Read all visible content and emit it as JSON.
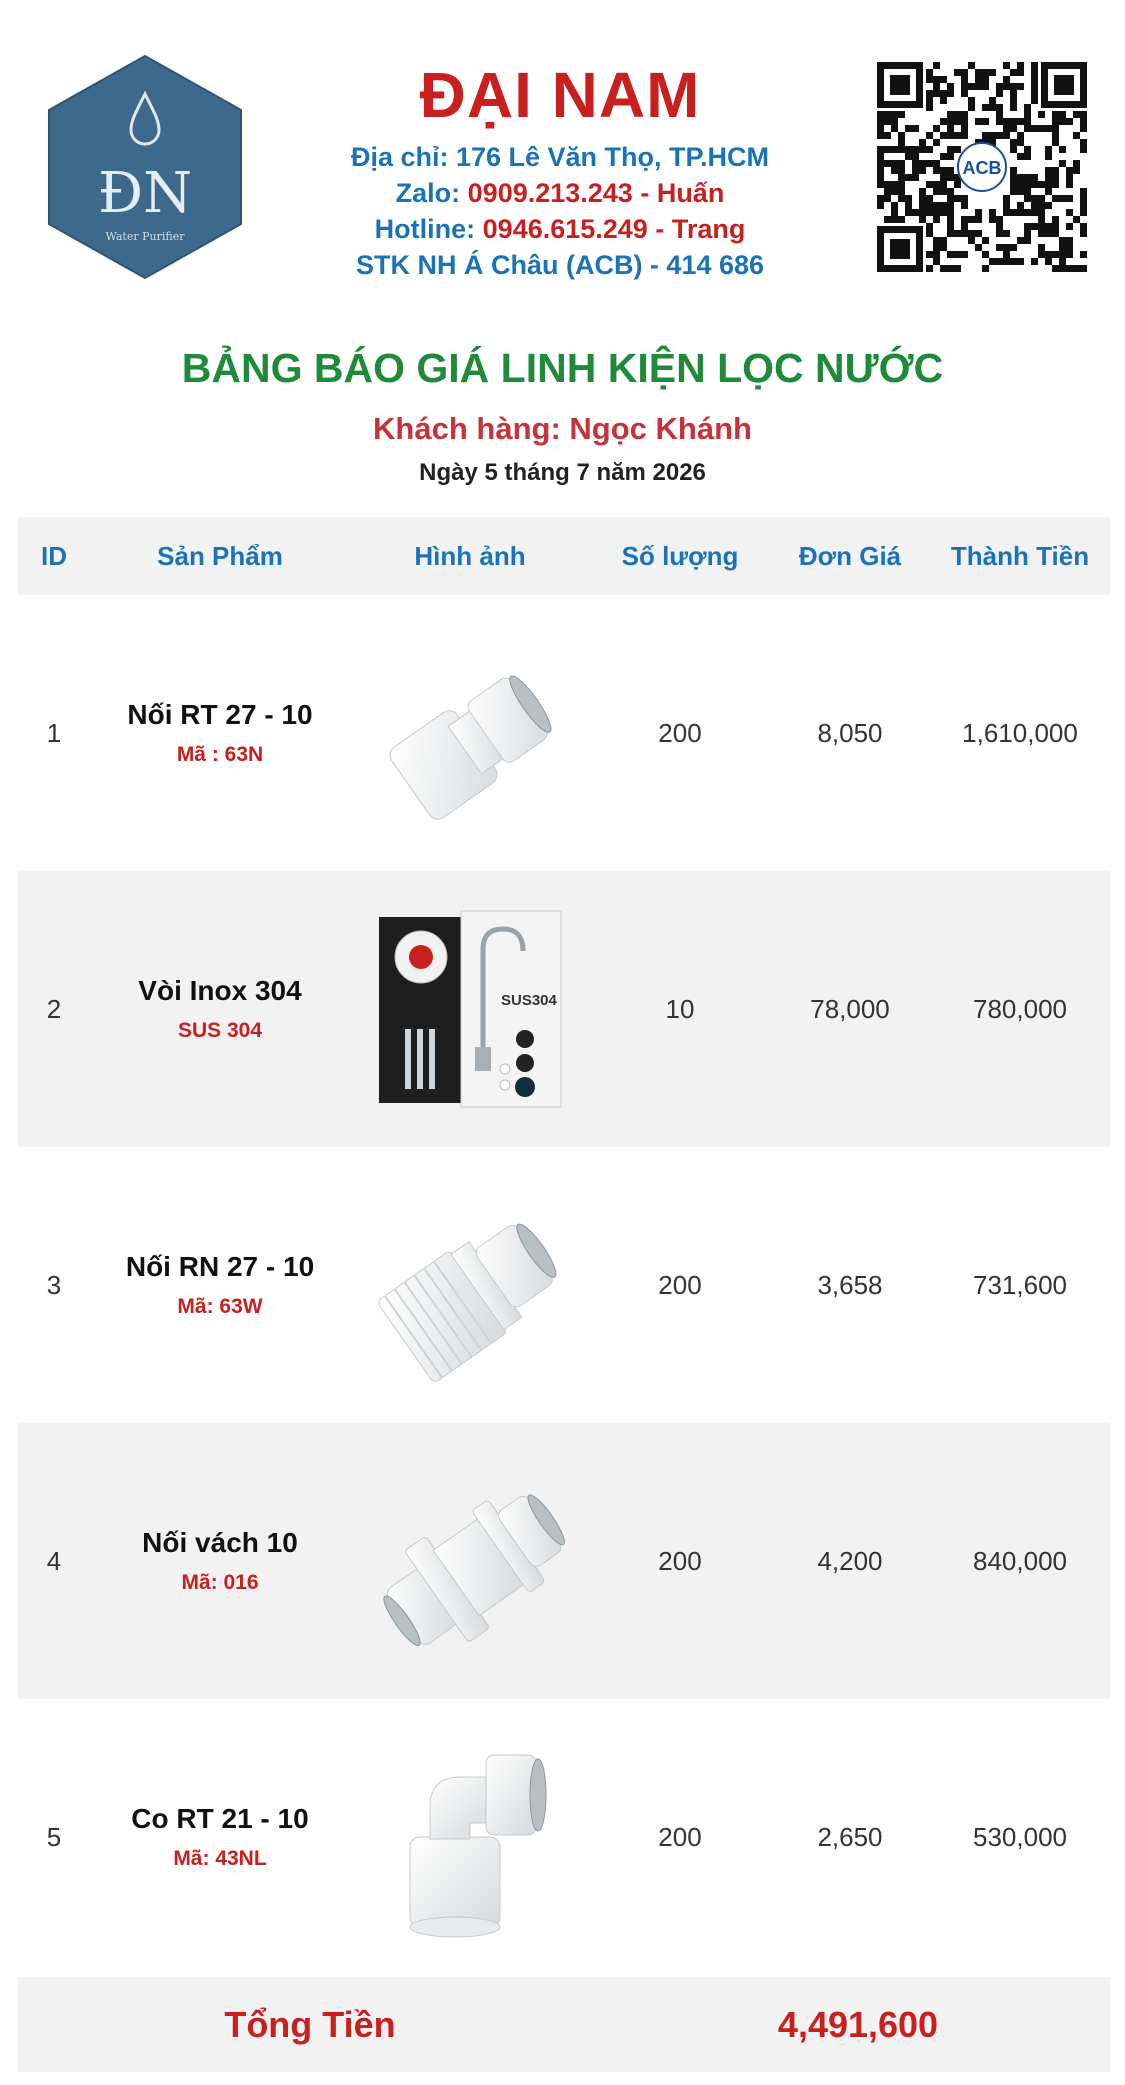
{
  "header": {
    "logo_text": "ĐN",
    "logo_subtext": "Water Purifier",
    "brand": "ĐẠI NAM",
    "address": "Địa chỉ: 176 Lê Văn Thọ, TP.HCM",
    "zalo_label": "Zalo: ",
    "zalo_value": "0909.213.243 - Huấn",
    "hotline_label": "Hotline: ",
    "hotline_value": "0946.615.249 - Trang",
    "bank": "STK NH Á Châu (ACB) - 414 686",
    "qr_badge": "ACB"
  },
  "title": "BẢNG BÁO GIÁ LINH KIỆN LỌC NƯỚC",
  "customer_label": "Khách hàng: ",
  "customer_name": "Ngọc Khánh",
  "date": "Ngày 5 tháng 7 năm 2026",
  "table": {
    "headers": {
      "id": "ID",
      "product": "Sản Phẩm",
      "image": "Hình ảnh",
      "qty": "Số lượng",
      "price": "Đơn Giá",
      "total": "Thành Tiền"
    },
    "rows": [
      {
        "id": "1",
        "name": "Nối RT 27 - 10",
        "code": "Mã : 63N",
        "qty": "200",
        "price": "8,050",
        "total": "1,610,000",
        "image_icon": "straight-female-connector-icon"
      },
      {
        "id": "2",
        "name": "Vòi Inox 304",
        "code": "SUS 304",
        "qty": "10",
        "price": "78,000",
        "total": "780,000",
        "image_icon": "stainless-faucet-package-icon",
        "image_label": "SUS304"
      },
      {
        "id": "3",
        "name": "Nối RN 27 - 10",
        "code": "Mã: 63W",
        "qty": "200",
        "price": "3,658",
        "total": "731,600",
        "image_icon": "male-thread-connector-icon"
      },
      {
        "id": "4",
        "name": "Nối vách 10",
        "code": "Mã: 016",
        "qty": "200",
        "price": "4,200",
        "total": "840,000",
        "image_icon": "bulkhead-connector-icon"
      },
      {
        "id": "5",
        "name": "Co RT 21 - 10",
        "code": "Mã: 43NL",
        "qty": "200",
        "price": "2,650",
        "total": "530,000",
        "image_icon": "elbow-connector-icon"
      }
    ]
  },
  "total_label": "Tổng Tiền",
  "total_value": "4,491,600",
  "colors": {
    "brand_red": "#c8201e",
    "info_blue": "#1a73b8",
    "title_green": "#1f8a3a",
    "row_alt": "#f2f2f2"
  }
}
